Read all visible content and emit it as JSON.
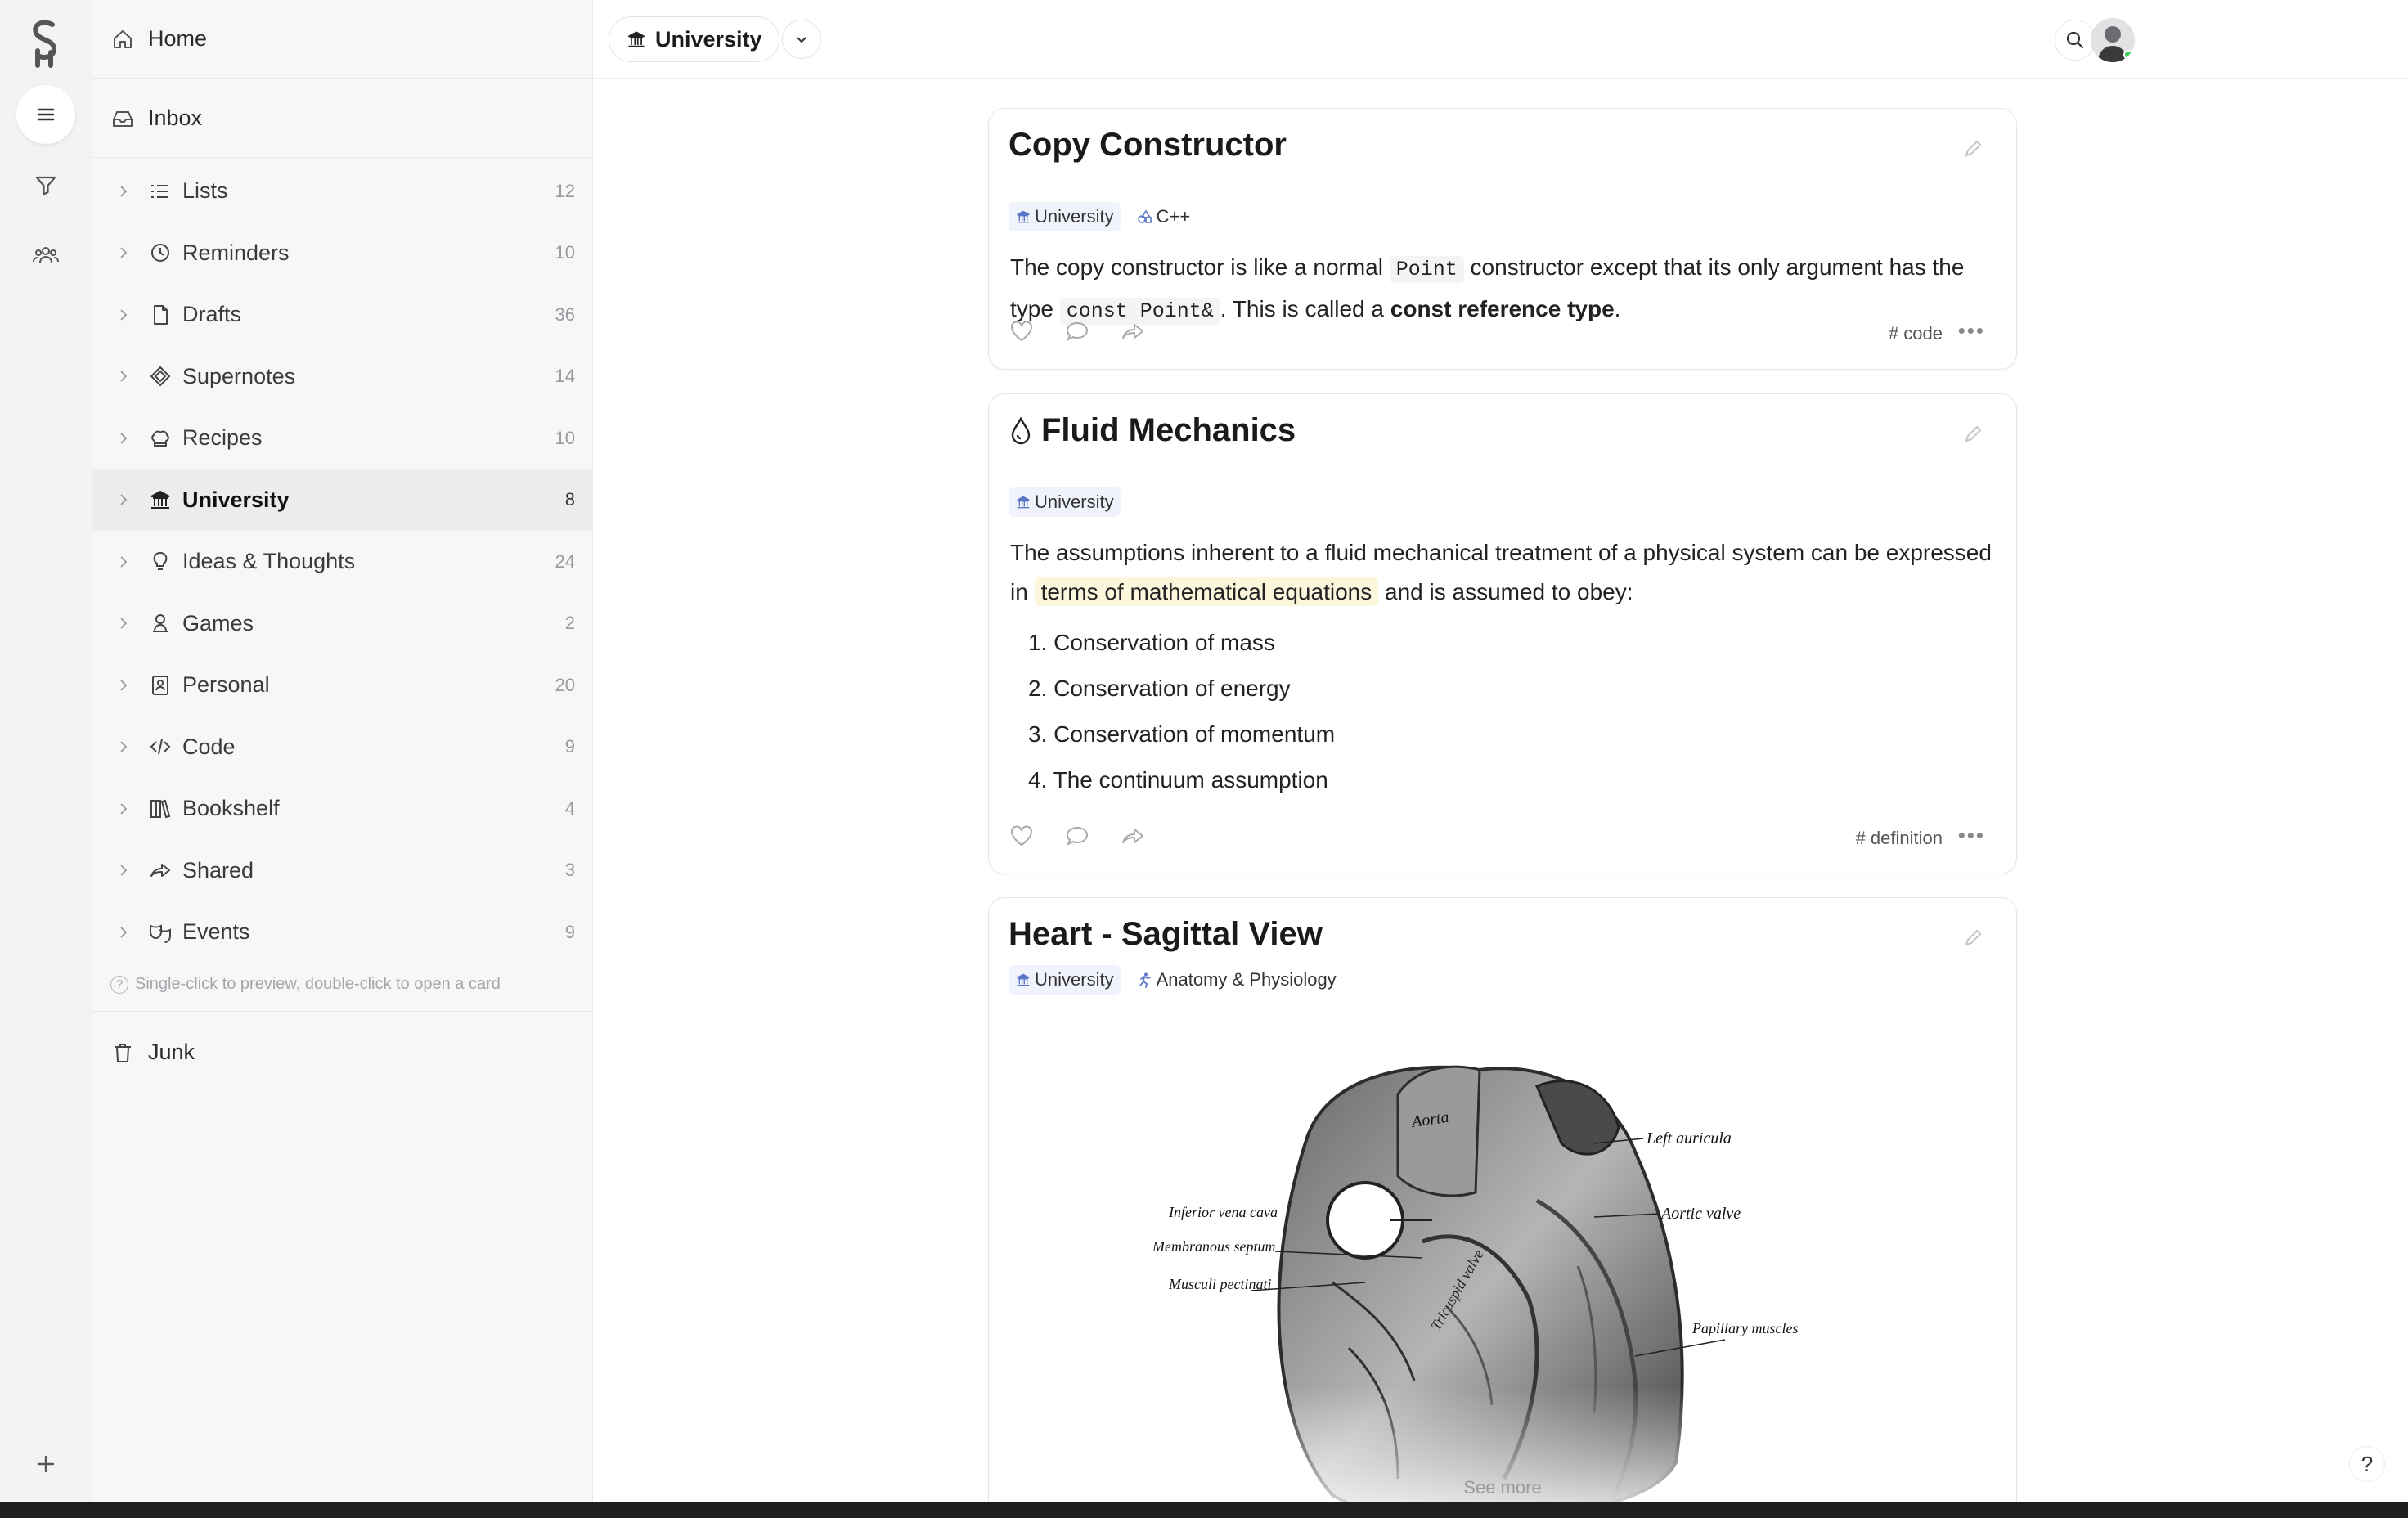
{
  "rail": {
    "logo_letter": "S"
  },
  "sidebar": {
    "home_label": "Home",
    "inbox_label": "Inbox",
    "items": [
      {
        "label": "Lists",
        "count": "12",
        "icon": "list-icon"
      },
      {
        "label": "Reminders",
        "count": "10",
        "icon": "clock-icon"
      },
      {
        "label": "Drafts",
        "count": "36",
        "icon": "document-icon"
      },
      {
        "label": "Supernotes",
        "count": "14",
        "icon": "diamond-icon"
      },
      {
        "label": "Recipes",
        "count": "10",
        "icon": "chef-hat-icon"
      },
      {
        "label": "University",
        "count": "8",
        "icon": "bank-icon",
        "active": true
      },
      {
        "label": "Ideas & Thoughts",
        "count": "24",
        "icon": "lightbulb-icon"
      },
      {
        "label": "Games",
        "count": "2",
        "icon": "user-icon"
      },
      {
        "label": "Personal",
        "count": "20",
        "icon": "contact-icon"
      },
      {
        "label": "Code",
        "count": "9",
        "icon": "code-icon"
      },
      {
        "label": "Bookshelf",
        "count": "4",
        "icon": "books-icon"
      },
      {
        "label": "Shared",
        "count": "3",
        "icon": "share-icon"
      },
      {
        "label": "Events",
        "count": "9",
        "icon": "masks-icon"
      }
    ],
    "hint": "Single-click to preview, double-click to open a card",
    "junk_label": "Junk"
  },
  "header": {
    "workspace_label": "University"
  },
  "cards": [
    {
      "title": "Copy Constructor",
      "tags": [
        "University",
        "C++"
      ],
      "body": {
        "t1": "The copy constructor is like a normal ",
        "code1": "Point",
        "t2": " constructor except that its only argument has the type ",
        "code2": "const Point&",
        "t3": ". This is called a ",
        "bold": "const reference type",
        "t4": "."
      },
      "hashtag": "# code"
    },
    {
      "title": "Fluid Mechanics",
      "tags": [
        "University"
      ],
      "body": {
        "t1": "The assumptions inherent to a fluid mechanical treatment of a physical system can be expressed in ",
        "highlight": "terms of mathematical equations",
        "t2": " and is assumed to obey:"
      },
      "list": [
        "1. Conservation of mass",
        "2. Conservation of energy",
        "3. Conservation of momentum",
        "4. The continuum assumption"
      ],
      "hashtag": "# definition"
    },
    {
      "title": "Heart - Sagittal View",
      "tags": [
        "University",
        "Anatomy & Physiology"
      ],
      "image_labels": {
        "aorta": "Aorta",
        "left_auricula": "Left auricula",
        "aortic_valve": "Aortic valve",
        "inferior_vena_cava": "Inferior vena cava",
        "membranous_septum": "Membranous septum",
        "musculi_pectinati": "Musculi pectinati",
        "papillary_muscles": "Papillary muscles",
        "tricuspid_valve": "Tricuspid valve"
      },
      "see_more": "See more"
    }
  ],
  "help_label": "?"
}
